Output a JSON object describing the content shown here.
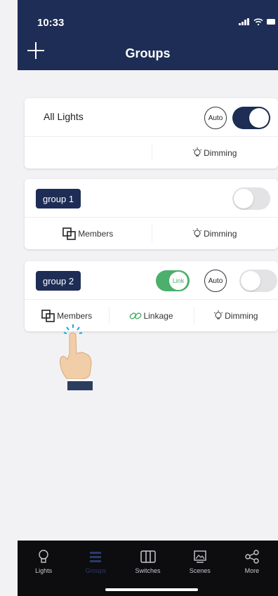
{
  "status": {
    "time": "10:33"
  },
  "header": {
    "title": "Groups"
  },
  "cards": [
    {
      "name": "All Lights",
      "auto": "Auto",
      "dimming": "Dimming",
      "power": "on"
    },
    {
      "name": "group 1",
      "members": "Members",
      "dimming": "Dimming",
      "power": "off"
    },
    {
      "name": "group 2",
      "link": "Link",
      "auto": "Auto",
      "members": "Members",
      "linkage": "Linkage",
      "dimming": "Dimming",
      "power": "off",
      "link_state": "on"
    }
  ],
  "tabs": [
    {
      "label": "Lights",
      "icon": "bulb-icon"
    },
    {
      "label": "Groups",
      "icon": "groups-icon",
      "active": true
    },
    {
      "label": "Switches",
      "icon": "switch-icon"
    },
    {
      "label": "Scenes",
      "icon": "scenes-icon"
    },
    {
      "label": "More",
      "icon": "share-icon"
    }
  ],
  "colors": {
    "navy": "#1d2d55",
    "green": "#4caf6c",
    "tabbar": "#0d0d10"
  }
}
